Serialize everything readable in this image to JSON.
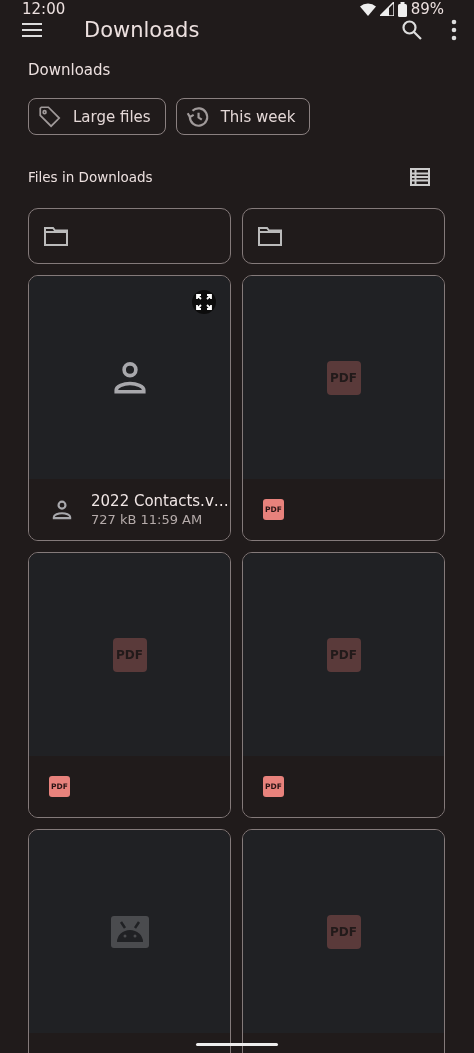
{
  "status_bar": {
    "time": "12:00",
    "battery": "89%"
  },
  "app_bar": {
    "title": "Downloads"
  },
  "breadcrumb": "Downloads",
  "chips": [
    {
      "label": "Large files",
      "kind": "tag"
    },
    {
      "label": "This week",
      "kind": "history"
    }
  ],
  "section": {
    "title": "Files in Downloads"
  },
  "folders": [
    {
      "kind": "folder"
    },
    {
      "kind": "folder"
    }
  ],
  "files": [
    {
      "kind": "contact",
      "name": "2022 Contacts.v…",
      "meta": "727 kB 11:59 AM",
      "expandable": true
    },
    {
      "kind": "pdf",
      "thumb_label": "PDF",
      "icon_label": "PDF"
    },
    {
      "kind": "pdf",
      "thumb_label": "PDF",
      "icon_label": "PDF"
    },
    {
      "kind": "pdf",
      "thumb_label": "PDF",
      "icon_label": "PDF"
    },
    {
      "kind": "android"
    },
    {
      "kind": "pdf",
      "thumb_label": "PDF"
    }
  ]
}
